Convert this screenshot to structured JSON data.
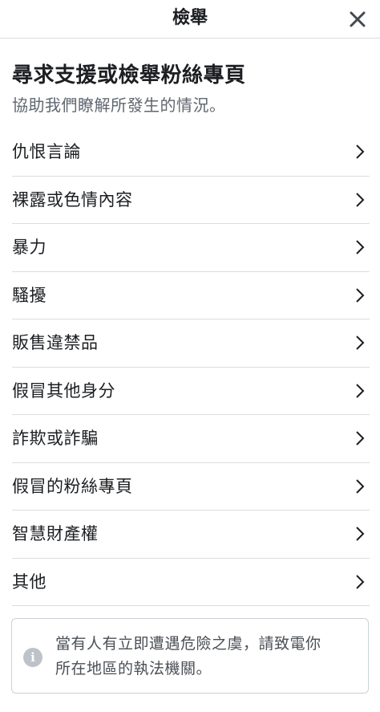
{
  "header": {
    "title": "檢舉",
    "close_icon": "close-icon"
  },
  "intro": {
    "title": "尋求支援或檢舉粉絲專頁",
    "subtitle": "協助我們瞭解所發生的情況。"
  },
  "options": [
    {
      "label": "仇恨言論"
    },
    {
      "label": "裸露或色情內容"
    },
    {
      "label": "暴力"
    },
    {
      "label": "騷擾"
    },
    {
      "label": "販售違禁品"
    },
    {
      "label": "假冒其他身分"
    },
    {
      "label": "詐欺或詐騙"
    },
    {
      "label": "假冒的粉絲專頁"
    },
    {
      "label": "智慧財產權"
    },
    {
      "label": "其他"
    }
  ],
  "notice": {
    "icon": "info-icon",
    "text_line1": "當有人有立即遭遇危險之虞，請致電你",
    "text_line2": "所在地區的執法機關。"
  },
  "colors": {
    "text": "#1c1e21",
    "secondary_text": "#606770",
    "divider": "#dadde1",
    "icon_gray": "#bec3c9"
  }
}
